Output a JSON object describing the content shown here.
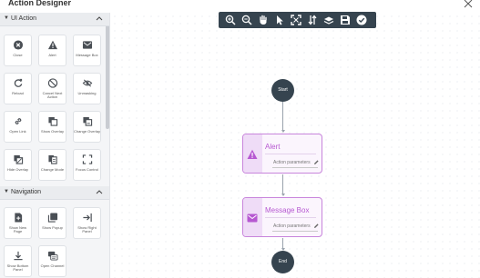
{
  "window": {
    "title": "Action Designer"
  },
  "sidebar": {
    "sections": [
      {
        "title": "UI Action",
        "items": [
          {
            "label": "Close",
            "icon": "close-circle-icon"
          },
          {
            "label": "Alert",
            "icon": "warning-icon"
          },
          {
            "label": "Message Box",
            "icon": "message-box-icon"
          },
          {
            "label": "Reload",
            "icon": "reload-icon"
          },
          {
            "label": "Cancel Next Action",
            "icon": "cancel-icon"
          },
          {
            "label": "Unmasking",
            "icon": "eye-off-icon"
          },
          {
            "label": "Open Link",
            "icon": "link-icon"
          },
          {
            "label": "Show Overlay",
            "icon": "overlay-icon"
          },
          {
            "label": "Change Overlay",
            "icon": "change-overlay-icon"
          },
          {
            "label": "Hide Overlay",
            "icon": "hide-overlay-icon"
          },
          {
            "label": "Change Mode",
            "icon": "change-mode-icon"
          },
          {
            "label": "Focus Control",
            "icon": "focus-icon"
          }
        ]
      },
      {
        "title": "Navigation",
        "items": [
          {
            "label": "Show New Page",
            "icon": "new-page-icon"
          },
          {
            "label": "Show Popup",
            "icon": "popup-icon"
          },
          {
            "label": "Show Right Panel",
            "icon": "right-panel-icon"
          },
          {
            "label": "Show Bottom Panel",
            "icon": "bottom-panel-icon"
          },
          {
            "label": "Open Channel",
            "icon": "channel-icon"
          }
        ]
      }
    ]
  },
  "toolbar": {
    "buttons": [
      "zoom-in-icon",
      "zoom-out-icon",
      "pan-hand-icon",
      "pointer-icon",
      "fit-screen-icon",
      "sort-icon",
      "layers-icon",
      "save-icon",
      "check-circle-icon"
    ]
  },
  "flow": {
    "start_label": "Start",
    "end_label": "End",
    "nodes": [
      {
        "title": "Alert",
        "params_label": "Action parameters",
        "icon": "warning-icon"
      },
      {
        "title": "Message Box",
        "params_label": "Action parameters",
        "icon": "message-box-icon"
      }
    ]
  },
  "colors": {
    "toolbar_bg": "#36444f",
    "node_border": "#c885dc",
    "node_title": "#b658d1",
    "panel_bg": "#f4f5f7"
  }
}
